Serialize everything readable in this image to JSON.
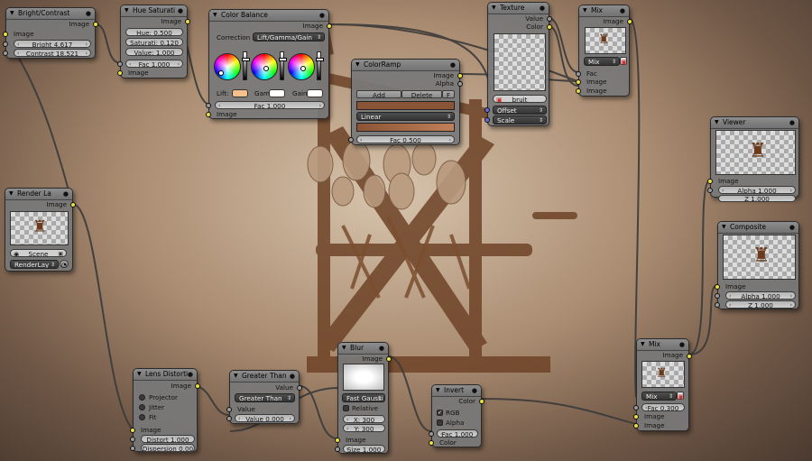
{
  "colors": {
    "socket_color": "#e8e040",
    "socket_value": "#9a9a9a",
    "socket_vector": "#6b6bd8",
    "link": "#3a3a3a",
    "node_bg": "#787878"
  },
  "nodes": {
    "bright_contrast": {
      "title": "Bright/Contrast",
      "out_image": "Image",
      "in_image": "Image",
      "bright": "Bright 4.617",
      "contrast": "Contrast 18.521"
    },
    "hue_saturation": {
      "title": "Hue Saturati",
      "out_image": "Image",
      "hue": "Hue: 0.500",
      "saturation": "Saturati: 0.120",
      "value": "Value: 1.000",
      "fac": "Fac 1.000",
      "in_image": "Image"
    },
    "color_balance": {
      "title": "Color Balance",
      "out_image": "Image",
      "correction_label": "Correction",
      "correction_value": "Lift/Gamma/Gain",
      "lift": "Lift:",
      "gamma": "Gam",
      "gain": "Gain",
      "fac": "Fac 1.000",
      "in_image": "Image",
      "lift_color": "#f5c08c",
      "gamma_color": "#ffffff",
      "gain_color": "#ffffff"
    },
    "texture": {
      "title": "Texture",
      "out_value": "Value",
      "out_color": "Color",
      "texture_name": "bruit",
      "offset": "Offset",
      "scale": "Scale"
    },
    "mix_top": {
      "title": "Mix",
      "out_image": "Image",
      "blend": "Mix",
      "in_fac": "Fac",
      "in_image1": "Image",
      "in_image2": "Image"
    },
    "color_ramp": {
      "title": "ColorRamp",
      "out_image": "Image",
      "out_alpha": "Alpha",
      "add": "Add",
      "delete": "Delete",
      "flip": "F",
      "interpolation": "Linear",
      "fac": "Fac 0.500",
      "ramp_start": "#8a5436",
      "ramp_end": "#c08058"
    },
    "viewer": {
      "title": "Viewer",
      "in_image": "Image",
      "alpha": "Alpha 1.000",
      "z": "Z 1.000"
    },
    "composite": {
      "title": "Composite",
      "in_image": "Image",
      "alpha": "Alpha 1.000",
      "z": "Z 1.000"
    },
    "render_layers": {
      "title": "Render La",
      "out_image": "Image",
      "scene": "Scene",
      "layer": "RenderLay"
    },
    "lens_distortion": {
      "title": "Lens Distorti",
      "out_image": "Image",
      "projector": "Projector",
      "jitter": "Jitter",
      "fit": "Fit",
      "in_image": "Image",
      "distort": "Distort 1.000",
      "dispersion": "Dispersion 0.00"
    },
    "greater_than": {
      "title": "Greater Than",
      "out_value": "Value",
      "operation": "Greater Than",
      "in_value_label": "Value",
      "value": "Value 0.000"
    },
    "blur": {
      "title": "Blur",
      "out_image": "Image",
      "filter": "Fast Gaussi",
      "relative": "Relative",
      "x": "X: 300",
      "y": "Y: 300",
      "in_image": "Image",
      "size": "Size 1.000"
    },
    "invert": {
      "title": "Invert",
      "out_color": "Color",
      "rgb": "RGB",
      "alpha": "Alpha",
      "fac": "Fac 1.000",
      "in_color": "Color"
    },
    "mix_bottom": {
      "title": "Mix",
      "out_image": "Image",
      "blend": "Mix",
      "fac": "Fac 0.300",
      "in_image1": "Image",
      "in_image2": "Image"
    }
  }
}
